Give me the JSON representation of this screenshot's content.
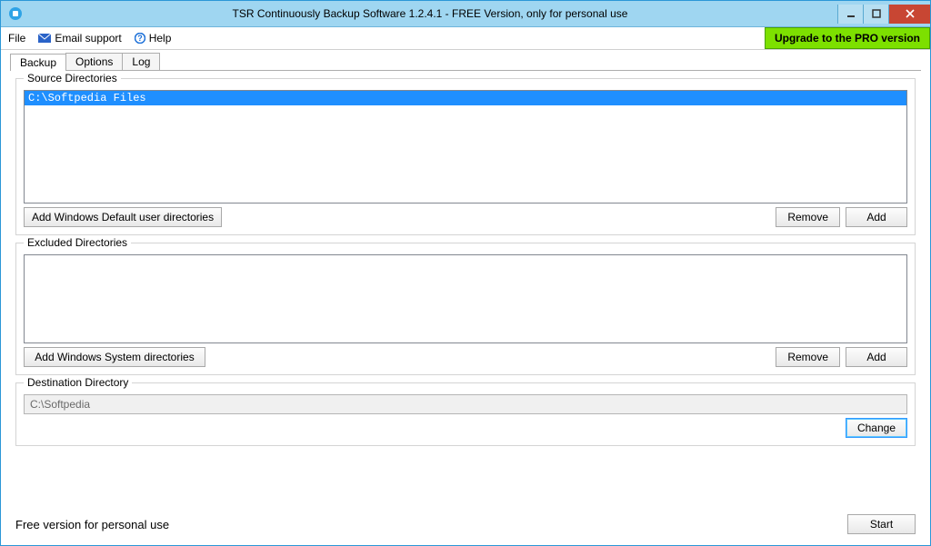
{
  "window": {
    "title": "TSR Continuously Backup Software 1.2.4.1 - FREE Version, only for personal use"
  },
  "menu": {
    "file": "File",
    "email_support": "Email support",
    "help": "Help",
    "upgrade": "Upgrade to the PRO version"
  },
  "tabs": {
    "backup": "Backup",
    "options": "Options",
    "log": "Log"
  },
  "source": {
    "legend": "Source Directories",
    "items": [
      "C:\\Softpedia Files"
    ],
    "add_default": "Add Windows Default user directories",
    "remove": "Remove",
    "add": "Add"
  },
  "excluded": {
    "legend": "Excluded Directories",
    "items": [],
    "add_system": "Add Windows System directories",
    "remove": "Remove",
    "add": "Add"
  },
  "destination": {
    "legend": "Destination Directory",
    "value": "C:\\Softpedia",
    "change": "Change"
  },
  "footer": {
    "message": "Free version for personal use",
    "start": "Start"
  }
}
